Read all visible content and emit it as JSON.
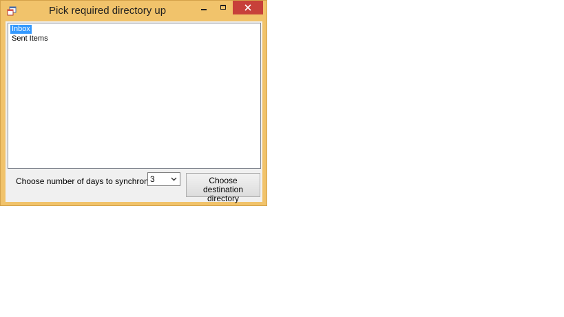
{
  "window": {
    "title": "Pick required directory up",
    "icon": "app-window-icon"
  },
  "titlebar_buttons": {
    "minimize_icon": "minimize-icon",
    "maximize_icon": "maximize-icon",
    "close_icon": "close-icon",
    "close_color": "#c7403a"
  },
  "folders": {
    "items": [
      {
        "label": "Inbox",
        "selected": true
      },
      {
        "label": "Sent Items",
        "selected": false
      }
    ],
    "selection_color": "#3399ff"
  },
  "sync": {
    "label": "Choose number of days to synchronize",
    "selected_days": "3"
  },
  "actions": {
    "choose_destination_label": "Choose destination directory"
  },
  "colors": {
    "window_frame": "#f1c36b",
    "client_background": "#f0f0f0"
  }
}
